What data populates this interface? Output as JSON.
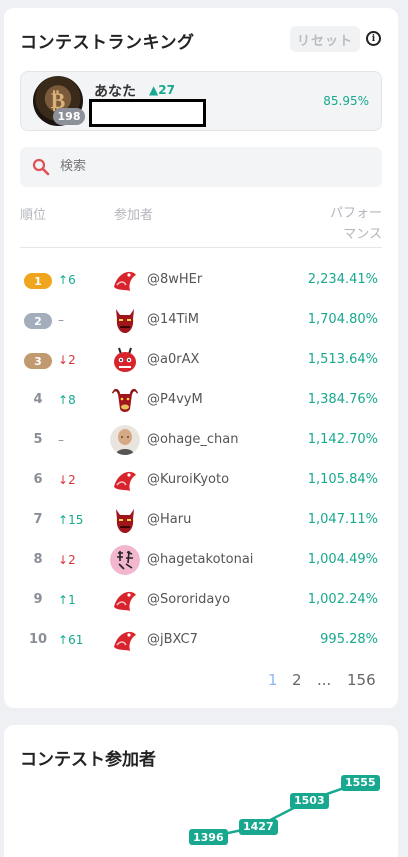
{
  "ranking": {
    "title": "コンテストランキング",
    "reset_label": "リセット",
    "info_glyph": "i",
    "me": {
      "name": "あなた",
      "rank": "198",
      "change": "27",
      "performance": "85.95%"
    },
    "search": {
      "placeholder": "検索"
    },
    "headers": {
      "rank": "順位",
      "participant": "参加者",
      "performance_line1": "パフォー",
      "performance_line2": "マンス"
    },
    "rows": [
      {
        "rank": "1",
        "change": "6",
        "dir": "up",
        "user": "@8wHEr",
        "perf": "2,234.41%",
        "avatar": "koi-avatar"
      },
      {
        "rank": "2",
        "change": "–",
        "dir": "same",
        "user": "@14TiM",
        "perf": "1,704.80%",
        "avatar": "demon-avatar"
      },
      {
        "rank": "3",
        "change": "2",
        "dir": "down",
        "user": "@a0rAX",
        "perf": "1,513.64%",
        "avatar": "oni-avatar"
      },
      {
        "rank": "4",
        "change": "8",
        "dir": "up",
        "user": "@P4vyM",
        "perf": "1,384.76%",
        "avatar": "bull-avatar"
      },
      {
        "rank": "5",
        "change": "–",
        "dir": "same",
        "user": "@ohage_chan",
        "perf": "1,142.70%",
        "avatar": "man-avatar"
      },
      {
        "rank": "6",
        "change": "2",
        "dir": "down",
        "user": "@KuroiKyoto",
        "perf": "1,105.84%",
        "avatar": "koi-avatar"
      },
      {
        "rank": "7",
        "change": "15",
        "dir": "up",
        "user": "@Haru",
        "perf": "1,047.11%",
        "avatar": "demon-avatar"
      },
      {
        "rank": "8",
        "change": "2",
        "dir": "down",
        "user": "@hagetakotonai",
        "perf": "1,004.49%",
        "avatar": "calligraphy-avatar"
      },
      {
        "rank": "9",
        "change": "1",
        "dir": "up",
        "user": "@Sororidayo",
        "perf": "1,002.24%",
        "avatar": "koi-avatar"
      },
      {
        "rank": "10",
        "change": "61",
        "dir": "up",
        "user": "@jBXC7",
        "perf": "995.28%",
        "avatar": "koi-avatar"
      }
    ],
    "pagination": {
      "current": "1",
      "next": "2",
      "ellipsis": "...",
      "last": "156"
    }
  },
  "participants": {
    "title": "コンテスト参加者",
    "chart_data": {
      "type": "line",
      "values": [
        1396,
        1427,
        1503,
        1555
      ],
      "labels": [
        "1396",
        "1427",
        "1503",
        "1555"
      ]
    }
  },
  "colors": {
    "accent": "#18a88f",
    "down": "#d9363e",
    "gold": "#f0a51f",
    "silver": "#a3adbb",
    "bronze": "#c19a70"
  }
}
